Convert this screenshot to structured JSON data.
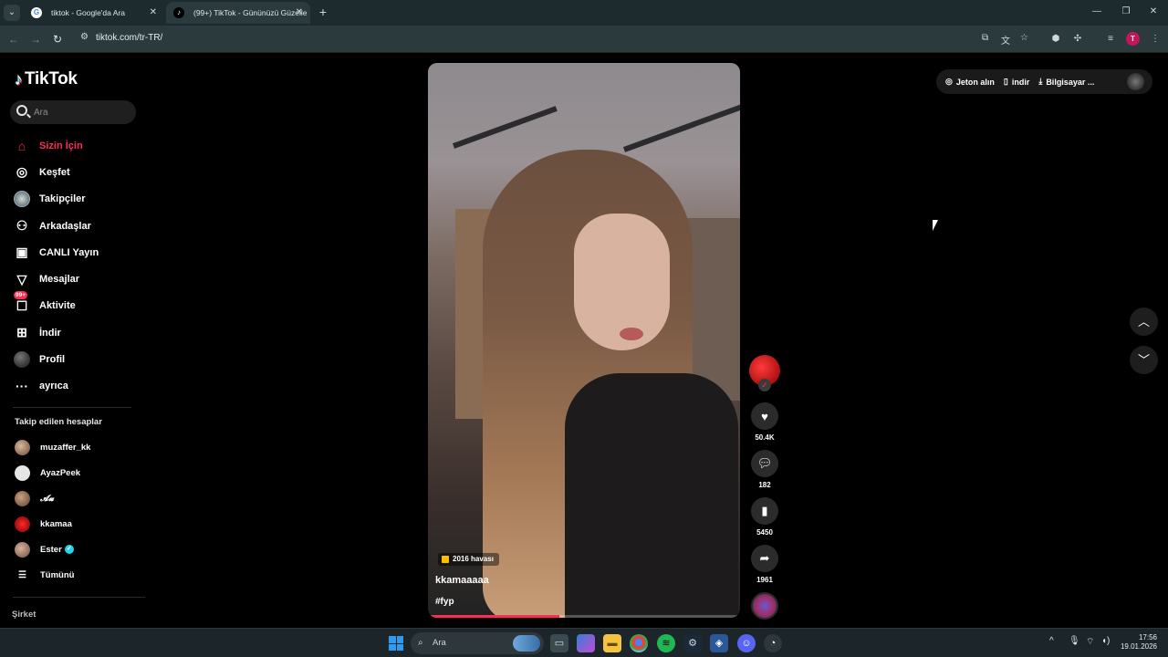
{
  "browser": {
    "tabs": [
      {
        "title": "tiktok - Google'da Ara",
        "favicon": "google-icon",
        "active": false
      },
      {
        "title": "(99+) TikTok - Gününüzü Güzelle",
        "favicon": "tiktok-icon",
        "active": true
      }
    ],
    "url": "tiktok.com/tr-TR/"
  },
  "sidebar": {
    "logo_text": "TikTok",
    "search_placeholder": "Ara",
    "nav": [
      {
        "label": "Sizin İçin",
        "icon": "home-icon",
        "active": true
      },
      {
        "label": "Keşfet",
        "icon": "compass-icon"
      },
      {
        "label": "Takipçiler",
        "icon": "avatar"
      },
      {
        "label": "Arkadaşlar",
        "icon": "friends-icon"
      },
      {
        "label": "CANLI Yayın",
        "icon": "live-icon"
      },
      {
        "label": "Mesajlar",
        "icon": "send-icon"
      },
      {
        "label": "Aktivite",
        "icon": "inbox-icon",
        "badge": "99+"
      },
      {
        "label": "İndir",
        "icon": "download-box-icon"
      },
      {
        "label": "Profil",
        "icon": "avatar"
      },
      {
        "label": "ayrıca",
        "icon": "more-icon"
      }
    ],
    "following_title": "Takip edilen hesaplar",
    "following": [
      {
        "name": "muzaffer_kk"
      },
      {
        "name": "AyazPeek"
      },
      {
        "name": "𝓐𝓾"
      },
      {
        "name": "kkamaa"
      },
      {
        "name": "Ester",
        "verified": true
      }
    ],
    "see_all": "Tümünü",
    "company": "Şirket"
  },
  "video": {
    "tag": "2016 havası",
    "author": "kkamaaaaa",
    "hashtag": "#fyp",
    "progress": 0.42
  },
  "actions": {
    "likes": "50.4K",
    "comments": "182",
    "saves": "5450",
    "shares": "1961"
  },
  "topbar": {
    "coins": "Jeton alın",
    "app": "indir",
    "desktop": "Bilgisayar ..."
  },
  "taskbar": {
    "search_placeholder": "Ara",
    "time": "17:56",
    "date": "19.01.2026"
  },
  "colors": {
    "accent": "#fe2c55",
    "verified": "#20d5ec"
  }
}
